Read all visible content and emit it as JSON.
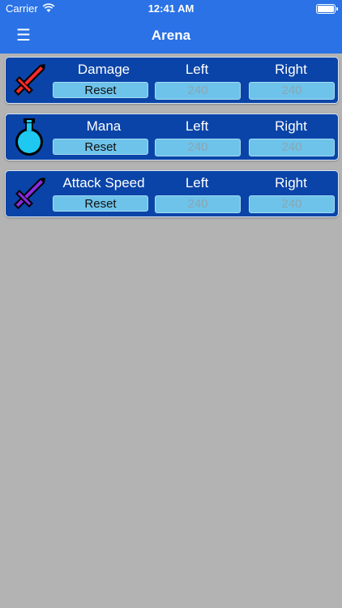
{
  "status_bar": {
    "carrier": "Carrier",
    "time": "12:41 AM",
    "wifi_icon": "wifi-icon",
    "battery_icon": "battery-icon"
  },
  "nav": {
    "menu_icon": "menu-icon",
    "menu_glyph": "☰",
    "title": "Arena"
  },
  "stats": [
    {
      "name": "Damage",
      "icon": "red-sword-icon",
      "icon_color": "#ff2a2a",
      "reset_label": "Reset",
      "left_label": "Left",
      "right_label": "Right",
      "left_value": "240",
      "right_value": "240"
    },
    {
      "name": "Mana",
      "icon": "mana-potion-icon",
      "icon_color": "#1ec8f0",
      "reset_label": "Reset",
      "left_label": "Left",
      "right_label": "Right",
      "left_value": "240",
      "right_value": "240"
    },
    {
      "name": "Attack Speed",
      "icon": "purple-sword-icon",
      "icon_color": "#8a2be2",
      "reset_label": "Reset",
      "left_label": "Left",
      "right_label": "Right",
      "left_value": "240",
      "right_value": "240"
    }
  ],
  "colors": {
    "header": "#2a72e6",
    "background": "#b3b3b3",
    "card": "#0a44a8",
    "button": "#6ec3ea"
  }
}
